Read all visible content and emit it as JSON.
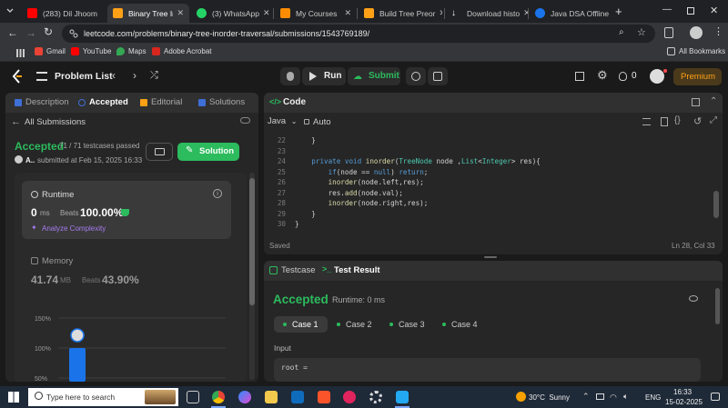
{
  "browser": {
    "tabs": [
      {
        "label": "(283) Dil Jhoom",
        "color": "#ff0000"
      },
      {
        "label": "Binary Tree Inor",
        "color": "#ffa116"
      },
      {
        "label": "(3) WhatsApp",
        "color": "#25d366"
      },
      {
        "label": "My Courses",
        "color": "#ff8c00"
      },
      {
        "label": "Build Tree Preor",
        "color": "#ffa116"
      },
      {
        "label": "Download histo",
        "color": "#ffffff"
      },
      {
        "label": "Java DSA Offline",
        "color": "#1a73e8"
      }
    ],
    "url": "leetcode.com/problems/binary-tree-inorder-traversal/submissions/1543769189/",
    "bookmarks": [
      {
        "label": "Gmail",
        "color": "#ea4335"
      },
      {
        "label": "YouTube",
        "color": "#ff0000"
      },
      {
        "label": "Maps",
        "color": "#34a853"
      },
      {
        "label": "Adobe Acrobat",
        "color": "#d7261e"
      }
    ],
    "all_bookmarks": "All Bookmarks"
  },
  "header": {
    "problem_list": "Problem List",
    "run": "Run",
    "submit": "Submit",
    "coins": "0",
    "premium": "Premium"
  },
  "left": {
    "tabs": [
      "Description",
      "Accepted",
      "Editorial",
      "Solutions"
    ],
    "all_submissions": "All Submissions",
    "status": "Accepted",
    "testcases": "71 / 71 testcases passed",
    "user": "A..",
    "submitted_at": "submitted at Feb 15, 2025 16:33",
    "solution_btn": "Solution",
    "runtime": {
      "title": "Runtime",
      "value": "0",
      "unit": "ms",
      "beats_label": "Beats",
      "beats": "100.00%",
      "analyze": "Analyze Complexity"
    },
    "memory": {
      "title": "Memory",
      "value": "41.74",
      "unit": "MB",
      "beats_label": "Beats",
      "beats": "43.90%"
    },
    "chart_ticks": [
      "150%",
      "100%",
      "50%"
    ]
  },
  "chart_data": {
    "type": "bar",
    "ylim": [
      50,
      150
    ],
    "yticks": [
      "150%",
      "100%",
      "50%"
    ],
    "values": [
      100
    ],
    "highlight": 0
  },
  "code": {
    "title": "Code",
    "language": "Java",
    "mode": "Auto",
    "lines": [
      {
        "n": "22",
        "html": "    }"
      },
      {
        "n": "23",
        "html": ""
      },
      {
        "n": "24",
        "html": "    <span class='kw'>private</span> <span class='kw'>void</span> <span class='fn'>inorder</span>(<span class='ty'>TreeNode</span> node ,<span class='ty'>List</span>&lt;<span class='ty'>Integer</span>&gt; res){"
      },
      {
        "n": "25",
        "html": "        <span class='kw'>if</span>(node == <span class='kw'>null</span>) <span class='kw'>return</span>;"
      },
      {
        "n": "26",
        "html": "        <span class='fn'>inorder</span>(node.left,res);"
      },
      {
        "n": "27",
        "html": "        res.<span class='fn'>add</span>(node.val);"
      },
      {
        "n": "28",
        "html": "        <span class='fn'>inorder</span>(node.right,res);"
      },
      {
        "n": "29",
        "html": "    }"
      },
      {
        "n": "30",
        "html": "}"
      }
    ],
    "saved": "Saved",
    "position": "Ln 28, Col 33"
  },
  "test": {
    "tabs": [
      "Testcase",
      "Test Result"
    ],
    "status": "Accepted",
    "runtime": "Runtime: 0 ms",
    "cases": [
      "Case 1",
      "Case 2",
      "Case 3",
      "Case 4"
    ],
    "input_label": "Input",
    "input_value": "root ="
  },
  "taskbar": {
    "search": "Type here to search",
    "weather": "30°C  Sunny",
    "lang": "ENG",
    "time": "16:33",
    "date": "15-02-2025"
  }
}
